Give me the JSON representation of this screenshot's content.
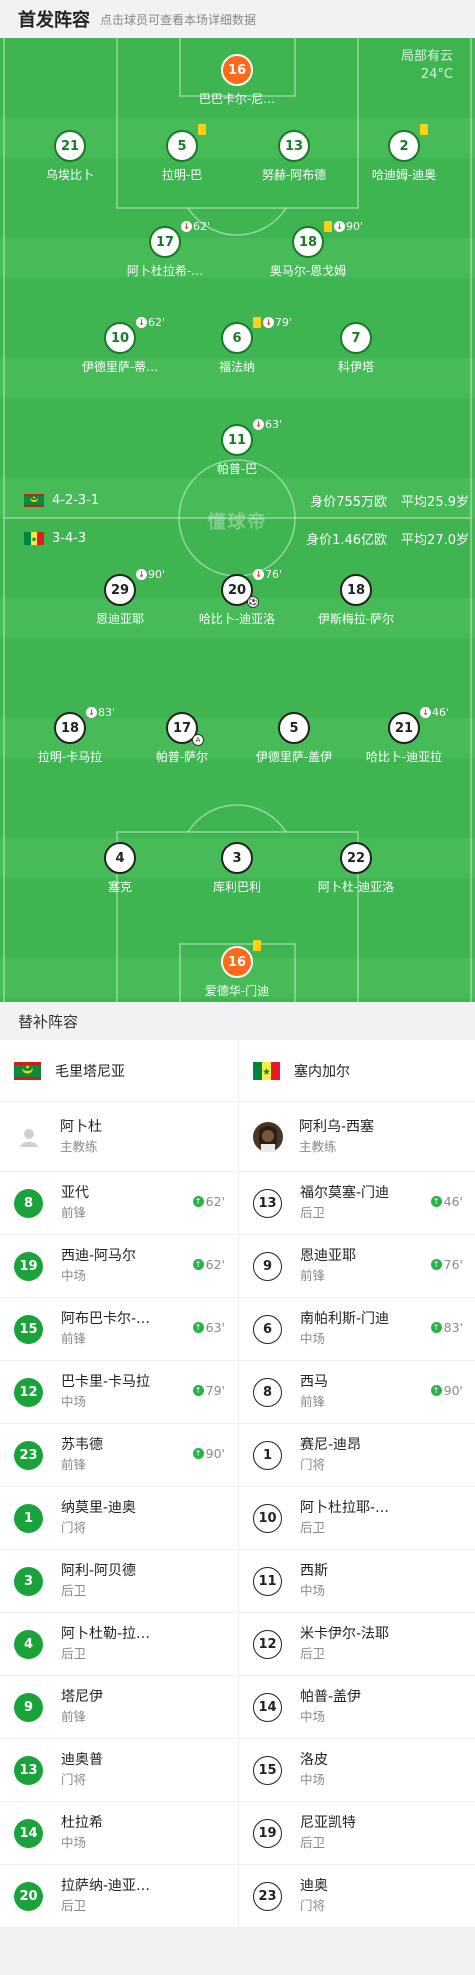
{
  "header": {
    "title": "首发阵容",
    "hint": "点击球员可查看本场详细数据"
  },
  "weather": {
    "condition": "局部有云",
    "temp": "24°C"
  },
  "watermark": "懂球帝",
  "home_team": {
    "name": "毛里塔尼亚",
    "formation": "4-2-3-1",
    "value": "身价755万欧",
    "avg_age": "平均25.9岁"
  },
  "away_team": {
    "name": "塞内加尔",
    "formation": "3-4-3",
    "value": "身价1.46亿欧",
    "avg_age": "平均27.0岁"
  },
  "home_lineup": [
    {
      "num": "16",
      "name": "巴巴卡尔-尼…",
      "gk": true
    },
    {
      "num": "21",
      "name": "乌埃比卜"
    },
    {
      "num": "5",
      "name": "拉明-巴",
      "ev": "",
      "yellow": true
    },
    {
      "num": "13",
      "name": "努赫-阿布德"
    },
    {
      "num": "2",
      "name": "哈迪姆-迪奥",
      "ev": "",
      "yellow": true
    },
    {
      "num": "17",
      "name": "阿卜杜拉希-…",
      "ev": "62'",
      "sub": true
    },
    {
      "num": "18",
      "name": "奥马尔-恩戈姆",
      "ev": "90'",
      "yellow": true,
      "sub": true
    },
    {
      "num": "10",
      "name": "伊德里萨-蒂…",
      "ev": "62'",
      "sub": true
    },
    {
      "num": "6",
      "name": "福法纳",
      "ev": "79'",
      "yellow": true,
      "sub": true
    },
    {
      "num": "7",
      "name": "科伊塔"
    },
    {
      "num": "11",
      "name": "帕普-巴",
      "ev": "63'",
      "sub": true
    }
  ],
  "away_lineup": [
    {
      "num": "29",
      "name": "恩迪亚耶",
      "ev": "90'",
      "sub": true
    },
    {
      "num": "20",
      "name": "哈比卜-迪亚洛",
      "ev": "76'",
      "sub": true,
      "goal": true
    },
    {
      "num": "18",
      "name": "伊斯梅拉-萨尔"
    },
    {
      "num": "18",
      "name": "拉明-卡马拉",
      "ev": "83'",
      "sub": true
    },
    {
      "num": "17",
      "name": "帕普-萨尔",
      "assist": true
    },
    {
      "num": "5",
      "name": "伊德里萨-盖伊"
    },
    {
      "num": "21",
      "name": "哈比卜-迪亚拉",
      "ev": "46'",
      "sub": true
    },
    {
      "num": "4",
      "name": "塞克"
    },
    {
      "num": "3",
      "name": "库利巴利"
    },
    {
      "num": "22",
      "name": "阿卜杜-迪亚洛"
    },
    {
      "num": "16",
      "name": "爱德华-门迪",
      "gk": true,
      "yellow": true
    }
  ],
  "subs_title": "替补阵容",
  "home_subs": {
    "coach": {
      "name": "阿卜杜",
      "role": "主教练"
    },
    "players": [
      {
        "num": "8",
        "name": "亚代",
        "pos": "前锋",
        "time": "62'"
      },
      {
        "num": "19",
        "name": "西迪-阿马尔",
        "pos": "中场",
        "time": "62'"
      },
      {
        "num": "15",
        "name": "阿布巴卡尔-…",
        "pos": "前锋",
        "time": "63'"
      },
      {
        "num": "12",
        "name": "巴卡里-卡马拉",
        "pos": "中场",
        "time": "79'"
      },
      {
        "num": "23",
        "name": "苏韦德",
        "pos": "前锋",
        "time": "90'"
      },
      {
        "num": "1",
        "name": "纳莫里-迪奥",
        "pos": "门将",
        "time": ""
      },
      {
        "num": "3",
        "name": "阿利-阿贝德",
        "pos": "后卫",
        "time": ""
      },
      {
        "num": "4",
        "name": "阿卜杜勒-拉…",
        "pos": "后卫",
        "time": ""
      },
      {
        "num": "9",
        "name": "塔尼伊",
        "pos": "前锋",
        "time": ""
      },
      {
        "num": "13",
        "name": "迪奥普",
        "pos": "门将",
        "time": ""
      },
      {
        "num": "14",
        "name": "杜拉希",
        "pos": "中场",
        "time": ""
      },
      {
        "num": "20",
        "name": "拉萨纳-迪亚…",
        "pos": "后卫",
        "time": ""
      }
    ]
  },
  "away_subs": {
    "coach": {
      "name": "阿利乌-西塞",
      "role": "主教练"
    },
    "players": [
      {
        "num": "13",
        "name": "福尔莫塞-门迪",
        "pos": "后卫",
        "time": "46'"
      },
      {
        "num": "9",
        "name": "恩迪亚耶",
        "pos": "前锋",
        "time": "76'"
      },
      {
        "num": "6",
        "name": "南帕利斯-门迪",
        "pos": "中场",
        "time": "83'"
      },
      {
        "num": "8",
        "name": "西马",
        "pos": "前锋",
        "time": "90'"
      },
      {
        "num": "1",
        "name": "赛尼-迪昂",
        "pos": "门将",
        "time": ""
      },
      {
        "num": "10",
        "name": "阿卜杜拉耶-…",
        "pos": "后卫",
        "time": ""
      },
      {
        "num": "11",
        "name": "西斯",
        "pos": "中场",
        "time": ""
      },
      {
        "num": "12",
        "name": "米卡伊尔-法耶",
        "pos": "后卫",
        "time": ""
      },
      {
        "num": "14",
        "name": "帕普-盖伊",
        "pos": "中场",
        "time": ""
      },
      {
        "num": "15",
        "name": "洛皮",
        "pos": "中场",
        "time": ""
      },
      {
        "num": "19",
        "name": "尼亚凯特",
        "pos": "后卫",
        "time": ""
      },
      {
        "num": "23",
        "name": "迪奥",
        "pos": "门将",
        "time": ""
      }
    ]
  }
}
